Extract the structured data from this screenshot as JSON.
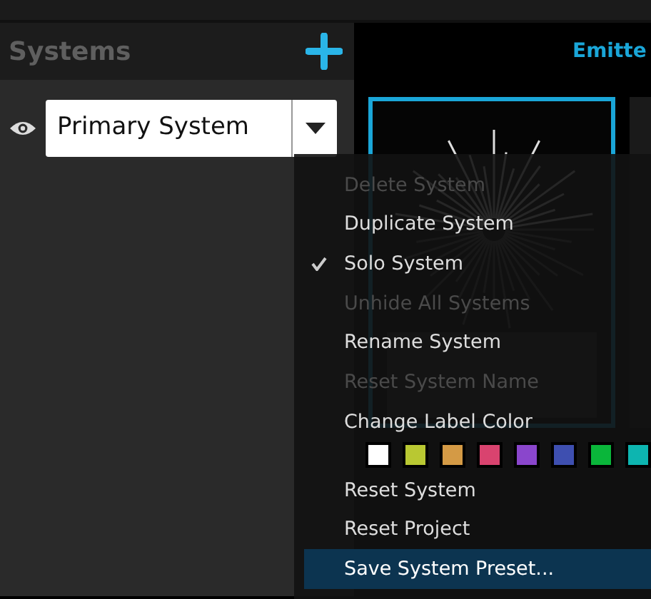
{
  "systems_panel": {
    "title": "Systems",
    "system_select": {
      "value": "Primary System",
      "visible": true
    }
  },
  "emitter_panel": {
    "tab_label": "Emitte",
    "cards": [
      {
        "selected": true
      }
    ]
  },
  "context_menu": {
    "items": [
      {
        "kind": "item",
        "label": "Delete System",
        "disabled": true,
        "checked": false,
        "selected": false
      },
      {
        "kind": "item",
        "label": "Duplicate System",
        "disabled": false,
        "checked": false,
        "selected": false
      },
      {
        "kind": "item",
        "label": "Solo System",
        "disabled": false,
        "checked": true,
        "selected": false
      },
      {
        "kind": "item",
        "label": "Unhide All Systems",
        "disabled": true,
        "checked": false,
        "selected": false
      },
      {
        "kind": "item",
        "label": "Rename System",
        "disabled": false,
        "checked": false,
        "selected": false
      },
      {
        "kind": "item",
        "label": "Reset System Name",
        "disabled": true,
        "checked": false,
        "selected": false
      },
      {
        "kind": "item",
        "label": "Change Label Color",
        "disabled": false,
        "checked": false,
        "selected": false
      },
      {
        "kind": "swatches",
        "swatches": [
          {
            "color": "#ffffff"
          },
          {
            "color": "#b9c832"
          },
          {
            "color": "#d49a45"
          },
          {
            "color": "#d9436f"
          },
          {
            "color": "#8a46cc"
          },
          {
            "color": "#3e4fb0"
          },
          {
            "color": "#0ab63a"
          },
          {
            "color": "#0db5b0"
          }
        ]
      },
      {
        "kind": "item",
        "label": "Reset System",
        "disabled": false,
        "checked": false,
        "selected": false
      },
      {
        "kind": "item",
        "label": "Reset Project",
        "disabled": false,
        "checked": false,
        "selected": false
      },
      {
        "kind": "item",
        "label": "Save System Preset...",
        "disabled": false,
        "checked": false,
        "selected": true
      }
    ]
  }
}
